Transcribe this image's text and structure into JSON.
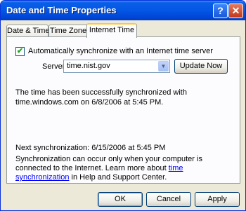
{
  "window": {
    "title": "Date and Time Properties"
  },
  "titlebar_buttons": {
    "help": "?",
    "close": "✕"
  },
  "tabs": [
    {
      "label": "Date & Time"
    },
    {
      "label": "Time Zone"
    },
    {
      "label": "Internet Time"
    }
  ],
  "sync": {
    "checkbox_checked": true,
    "checkbox_mark": "✔",
    "checkbox_label": "Automatically synchronize with an Internet time server",
    "server_label": "Server:",
    "server_value": "time.nist.gov",
    "update_button": "Update Now",
    "status_text": "The time has been successfully synchronized with time.windows.com on 6/8/2006 at 5:45 PM.",
    "next_sync": "Next synchronization: 6/15/2006 at 5:45 PM",
    "note_before": "Synchronization can occur only when your computer is connected to the Internet.  Learn more about ",
    "note_link": "time synchronization",
    "note_after": " in Help and Support Center."
  },
  "buttons": {
    "ok": "OK",
    "cancel": "Cancel",
    "apply": "Apply"
  },
  "colors": {
    "titlebar": "#0456e4",
    "face": "#ece9d8",
    "tab_highlight": "#ffc83c",
    "link": "#0000ff"
  }
}
